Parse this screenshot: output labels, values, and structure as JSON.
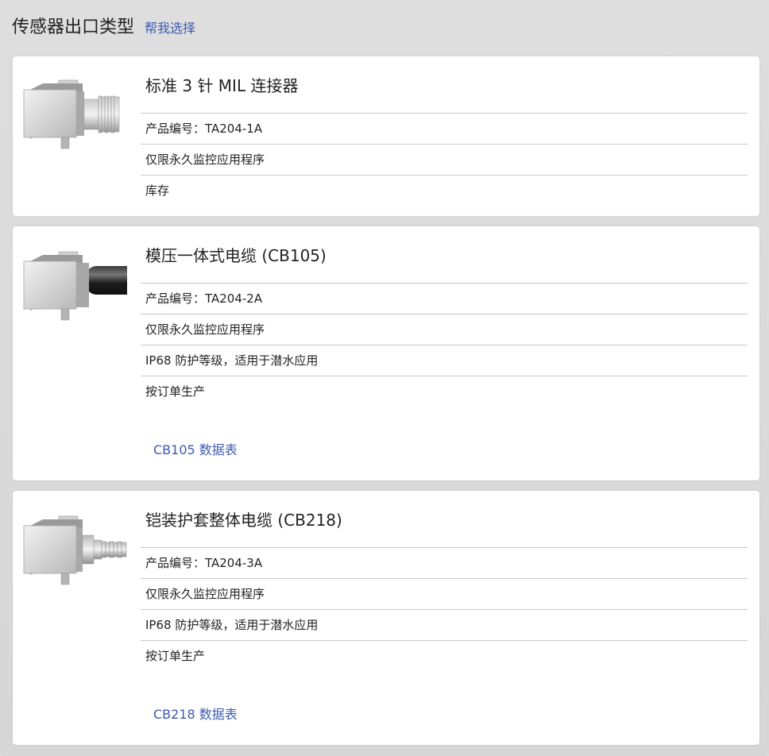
{
  "header": {
    "title": "传感器出口类型",
    "help_link": "帮我选择"
  },
  "cards": [
    {
      "title": "标准 3 针 MIL 连接器",
      "part_number": "产品编号：TA204-1A",
      "note": "仅限永久监控应用程序",
      "status": "库存",
      "image_icon": "sensor-mil-connector-icon"
    },
    {
      "title": "模压一体式电缆 (CB105)",
      "part_number": "产品编号：TA204-2A",
      "note": "仅限永久监控应用程序",
      "rating": "IP68 防护等级，适用于潜水应用",
      "status": "按订单生产",
      "datasheet": "CB105 数据表",
      "image_icon": "sensor-molded-cable-icon"
    },
    {
      "title": "铠装护套整体电缆 (CB218)",
      "part_number": "产品编号：TA204-3A",
      "note": "仅限永久监控应用程序",
      "rating": "IP68 防护等级，适用于潜水应用",
      "status": "按订单生产",
      "datasheet": "CB218 数据表",
      "image_icon": "sensor-armored-cable-icon"
    }
  ],
  "colors": {
    "link": "#3f5ab0",
    "background": "#dcdcdc",
    "card": "#ffffff",
    "divider": "#c8c8c8"
  }
}
